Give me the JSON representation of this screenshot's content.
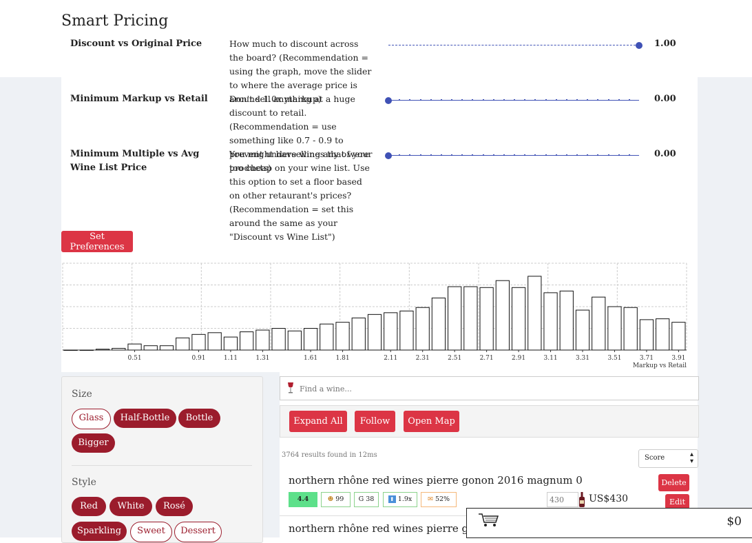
{
  "page": {
    "title": "Smart Pricing"
  },
  "preferences": [
    {
      "label": "Discount vs Original Price",
      "description": "How much to discount across the board? (Recommendation = using the graph, move the slider to where the average price is around 1.0x markup)",
      "value": "1.00",
      "slider_level": 1.0
    },
    {
      "label": "Minimum Markup vs Retail",
      "description": "Don't sell anything at a huge discount to retail. (Recommendation = use something like 0.7 - 0.9 to prevent underselling any of your products)",
      "value": "0.00",
      "slider_level": 0.0
    },
    {
      "label": "Minimum Multiple vs Avg Wine List Price",
      "description": "You might have wines that were too cheap on your wine list. Use this option to set a floor based on other retaurant's prices? (Recommendation = set this around the same as your \"Discount vs Wine List\")",
      "value": "0.00",
      "slider_level": 0.0
    }
  ],
  "set_preferences_label": "Set Preferences",
  "chart_data": {
    "type": "bar",
    "xlabel": "Markup vs Retail",
    "ylabel": "",
    "tick_labels": [
      "0.51",
      "0.91",
      "1.11",
      "1.31",
      "1.61",
      "1.81",
      "2.11",
      "2.31",
      "2.51",
      "2.71",
      "2.91",
      "3.11",
      "3.31",
      "3.51",
      "3.71",
      "3.91"
    ],
    "bins": [
      0.11,
      0.21,
      0.31,
      0.41,
      0.51,
      0.61,
      0.71,
      0.81,
      0.91,
      1.01,
      1.11,
      1.21,
      1.31,
      1.41,
      1.51,
      1.61,
      1.71,
      1.81,
      1.91,
      2.01,
      2.11,
      2.21,
      2.31,
      2.41,
      2.51,
      2.61,
      2.71,
      2.81,
      2.91,
      3.01,
      3.11,
      3.21,
      3.31,
      3.41,
      3.51,
      3.61,
      3.71,
      3.81,
      3.91
    ],
    "values": [
      0,
      0,
      1,
      2,
      7,
      5,
      5,
      14,
      18,
      20,
      15,
      21,
      23,
      25,
      22,
      25,
      30,
      32,
      37,
      41,
      43,
      45,
      49,
      60,
      73,
      73,
      72,
      80,
      72,
      85,
      66,
      68,
      46,
      61,
      50,
      49,
      35,
      36,
      32
    ],
    "ylim": [
      0,
      100
    ],
    "grid": true
  },
  "filters": {
    "size": {
      "heading": "Size",
      "options": [
        {
          "label": "Glass",
          "selected": false
        },
        {
          "label": "Half-Bottle",
          "selected": true
        },
        {
          "label": "Bottle",
          "selected": true
        },
        {
          "label": "Bigger",
          "selected": true
        }
      ]
    },
    "style": {
      "heading": "Style",
      "options": [
        {
          "label": "Red",
          "selected": true
        },
        {
          "label": "White",
          "selected": true
        },
        {
          "label": "Rosé",
          "selected": true
        },
        {
          "label": "Sparkling",
          "selected": true
        },
        {
          "label": "Sweet",
          "selected": false
        },
        {
          "label": "Dessert",
          "selected": false
        }
      ]
    }
  },
  "search": {
    "placeholder": "Find a wine..."
  },
  "actions": {
    "expand_all": "Expand All",
    "follow": "Follow",
    "open_map": "Open Map"
  },
  "results": {
    "count_text": "3764 results found in 12ms",
    "sort_value": "Score"
  },
  "wines": [
    {
      "title": "northern rhône red wines pierre gonon 2016 magnum 0",
      "rating": "4.4",
      "score_badge": "99",
      "g_badge": "G 38",
      "markup_badge": "1.9x",
      "percent_badge": "52%",
      "price_input": "430",
      "price": "US$430",
      "delete_label": "Delete",
      "edit_label": "Edit"
    },
    {
      "title": "northern rhône red wines pierre gonon"
    }
  ],
  "cart": {
    "total": "$0"
  },
  "colors": {
    "accent": "#dc3545",
    "pill": "#9b1c2c",
    "slider": "#3f51b5"
  }
}
